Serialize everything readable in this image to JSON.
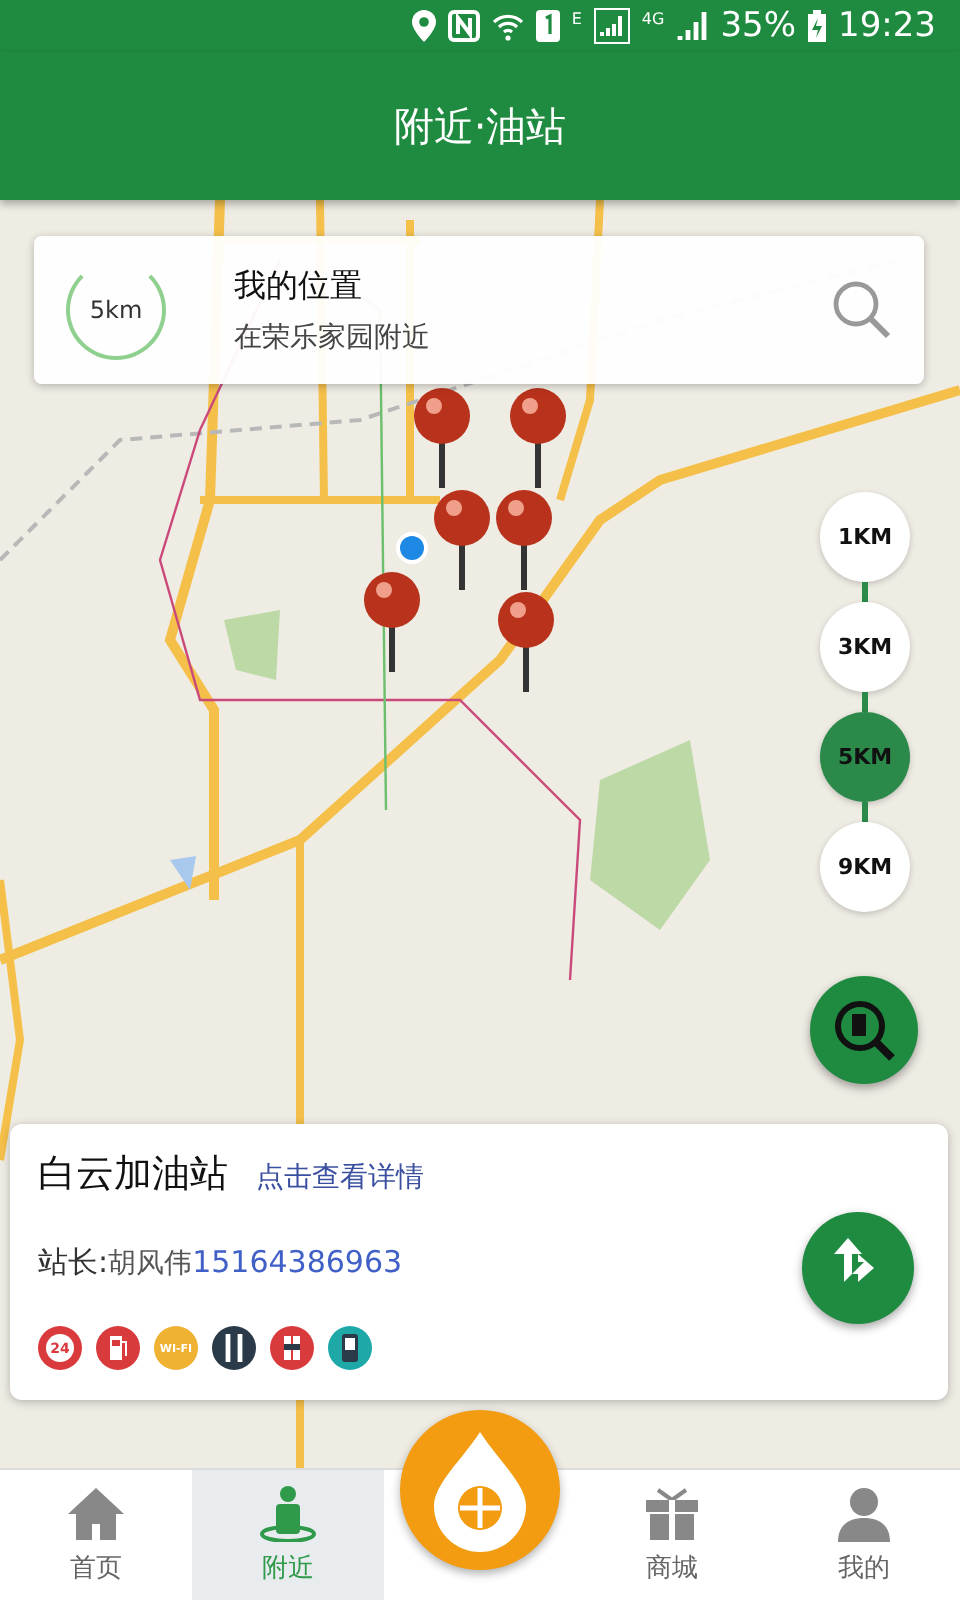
{
  "status_bar": {
    "network_small": "E",
    "network_type": "4G",
    "battery": "35%",
    "time": "19:23"
  },
  "header": {
    "title": "附近·油站"
  },
  "location_card": {
    "radius": "5km",
    "title": "我的位置",
    "subtitle": "在荣乐家园附近"
  },
  "zoom_levels": [
    {
      "label": "1KM",
      "selected": false
    },
    {
      "label": "3KM",
      "selected": false
    },
    {
      "label": "5KM",
      "selected": true
    },
    {
      "label": "9KM",
      "selected": false
    }
  ],
  "station": {
    "name": "白云加油站",
    "detail_link": "点击查看详情",
    "manager_label": "站长:",
    "manager_name": "胡风伟",
    "phone": "15164386963",
    "amenities": [
      {
        "kind": "hours",
        "text": "24",
        "color": "#d93a3c"
      },
      {
        "kind": "fuel",
        "color": "#d93a3c"
      },
      {
        "kind": "wifi",
        "text": "WI-FI",
        "color": "#f0b232"
      },
      {
        "kind": "tools",
        "color": "#2b3a48"
      },
      {
        "kind": "extinguisher",
        "color": "#d93a3c"
      },
      {
        "kind": "phone",
        "color": "#1ea8a8"
      }
    ]
  },
  "nav": [
    {
      "kind": "home",
      "label": "首页",
      "selected": false
    },
    {
      "kind": "nearby",
      "label": "附近",
      "selected": true
    },
    {
      "kind": "shop",
      "label": "商城",
      "selected": false
    },
    {
      "kind": "me",
      "label": "我的",
      "selected": false
    }
  ]
}
